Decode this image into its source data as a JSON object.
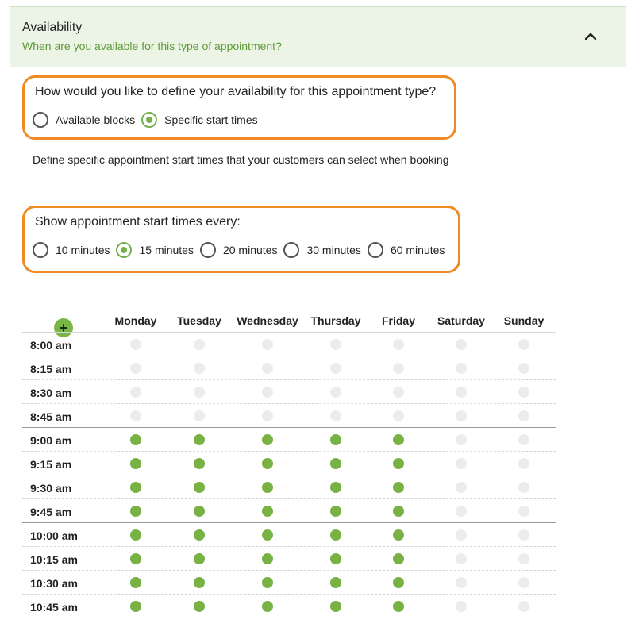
{
  "section": {
    "title": "Availability",
    "subtitle": "When are you available for this type of appointment?"
  },
  "define": {
    "question": "How would you like to define your availability for this appointment type?",
    "options": [
      {
        "label": "Available blocks",
        "checked": false
      },
      {
        "label": "Specific start times",
        "checked": true
      }
    ]
  },
  "description": "Define specific appointment start times that your customers can select when booking",
  "interval": {
    "question": "Show appointment start times every:",
    "options": [
      {
        "label": "10 minutes",
        "checked": false
      },
      {
        "label": "15 minutes",
        "checked": true
      },
      {
        "label": "20 minutes",
        "checked": false
      },
      {
        "label": "30 minutes",
        "checked": false
      },
      {
        "label": "60 minutes",
        "checked": false
      }
    ]
  },
  "schedule": {
    "add_label": "+",
    "days": [
      "Monday",
      "Tuesday",
      "Wednesday",
      "Thursday",
      "Friday",
      "Saturday",
      "Sunday"
    ],
    "slots": [
      {
        "time": "8:00 am",
        "on": [
          false,
          false,
          false,
          false,
          false,
          false,
          false
        ]
      },
      {
        "time": "8:15 am",
        "on": [
          false,
          false,
          false,
          false,
          false,
          false,
          false
        ]
      },
      {
        "time": "8:30 am",
        "on": [
          false,
          false,
          false,
          false,
          false,
          false,
          false
        ]
      },
      {
        "time": "8:45 am",
        "on": [
          false,
          false,
          false,
          false,
          false,
          false,
          false
        ]
      },
      {
        "time": "9:00 am",
        "on": [
          true,
          true,
          true,
          true,
          true,
          false,
          false
        ]
      },
      {
        "time": "9:15 am",
        "on": [
          true,
          true,
          true,
          true,
          true,
          false,
          false
        ]
      },
      {
        "time": "9:30 am",
        "on": [
          true,
          true,
          true,
          true,
          true,
          false,
          false
        ]
      },
      {
        "time": "9:45 am",
        "on": [
          true,
          true,
          true,
          true,
          true,
          false,
          false
        ]
      },
      {
        "time": "10:00 am",
        "on": [
          true,
          true,
          true,
          true,
          true,
          false,
          false
        ]
      },
      {
        "time": "10:15 am",
        "on": [
          true,
          true,
          true,
          true,
          true,
          false,
          false
        ]
      },
      {
        "time": "10:30 am",
        "on": [
          true,
          true,
          true,
          true,
          true,
          false,
          false
        ]
      },
      {
        "time": "10:45 am",
        "on": [
          true,
          true,
          true,
          true,
          true,
          false,
          false
        ]
      }
    ]
  },
  "colors": {
    "accent_green": "#78b144",
    "highlight_orange": "#f08a24",
    "header_bg": "#ecf5e5"
  }
}
